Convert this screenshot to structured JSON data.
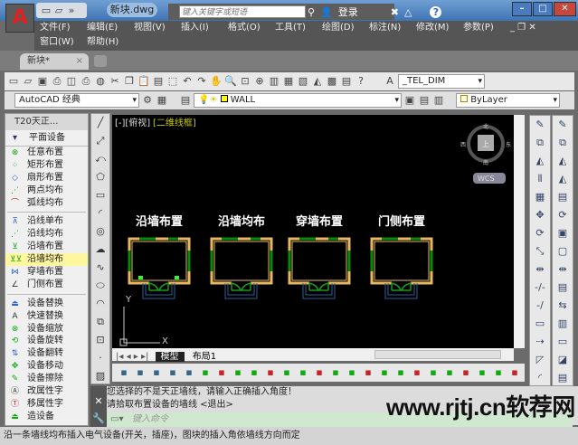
{
  "title": {
    "document": "新块.dwg",
    "search_placeholder": "键入关键字或短语",
    "login": "登录",
    "help": "?"
  },
  "menu": {
    "row1": [
      "文件(F)",
      "编辑(E)",
      "视图(V)",
      "插入(I)",
      "格式(O)",
      "工具(T)",
      "绘图(D)",
      "标注(N)",
      "修改(M)",
      "参数(P)"
    ],
    "row2": [
      "窗口(W)",
      "帮助(H)"
    ]
  },
  "doc_tab": {
    "label": "新块*",
    "close": "×"
  },
  "toolbar": {
    "textstyle": "_TEL_DIM",
    "workspace": "AutoCAD 经典",
    "layer": "WALL",
    "color": "ByLayer"
  },
  "panel": {
    "title": "T20天正...",
    "header": "平面设备",
    "groups": [
      [
        {
          "label": "任意布置",
          "icon": "⊗",
          "color": "#1a1"
        },
        {
          "label": "矩形布置",
          "icon": "⁘",
          "color": "#1a1"
        },
        {
          "label": "扇形布置",
          "icon": "◇",
          "color": "#36c"
        },
        {
          "label": "两点均布",
          "icon": "⋰",
          "color": "#1a1"
        },
        {
          "label": "弧线均布",
          "icon": "⌒",
          "color": "#c22"
        }
      ],
      [
        {
          "label": "沿线单布",
          "icon": "⊼",
          "color": "#36c"
        },
        {
          "label": "沿线均布",
          "icon": "⋰",
          "color": "#1a1"
        },
        {
          "label": "沿墙布置",
          "icon": "⊻",
          "color": "#1a1"
        },
        {
          "label": "沿墙均布",
          "icon": "⊻⊻",
          "color": "#1a1",
          "selected": true
        },
        {
          "label": "穿墙布置",
          "icon": "⋈",
          "color": "#36c"
        },
        {
          "label": "门侧布置",
          "icon": "∠",
          "color": "#333"
        }
      ],
      [
        {
          "label": "设备替换",
          "icon": "⏏",
          "color": "#36c"
        },
        {
          "label": "快速替换",
          "icon": "A",
          "color": "#333"
        },
        {
          "label": "设备缩放",
          "icon": "⊗",
          "color": "#1a1"
        },
        {
          "label": "设备旋转",
          "icon": "⟲",
          "color": "#1a1"
        },
        {
          "label": "设备翻转",
          "icon": "⇅",
          "color": "#36c"
        },
        {
          "label": "设备移动",
          "icon": "✥",
          "color": "#1a1"
        },
        {
          "label": "设备擦除",
          "icon": "✎",
          "color": "#1a1"
        },
        {
          "label": "改属性字",
          "icon": "Ⓐ",
          "color": "#333"
        },
        {
          "label": "移属性字",
          "icon": "Ⓣ",
          "color": "#c22"
        },
        {
          "label": "造设备",
          "icon": "⏏",
          "color": "#1a1"
        }
      ]
    ]
  },
  "viewport": {
    "label_prefix": "[-][俯视]",
    "label_style": "[二维线框]",
    "compass": {
      "north": "北",
      "south": "南",
      "east": "东",
      "west": "西",
      "center": "上"
    },
    "wcs": "WCS",
    "axis_x": "X",
    "axis_y": "Y"
  },
  "drawing": {
    "rooms": [
      "沿墙布置",
      "沿墙均布",
      "穿墙布置",
      "门侧布置"
    ]
  },
  "layout_tabs": {
    "model": "模型",
    "layout1": "布局1"
  },
  "command": {
    "history": [
      "您选择的不是天正墙线，请输入正确插入角度！",
      "请拾取布置设备的墙线 <退出>"
    ],
    "placeholder": "键入命令"
  },
  "status": "沿一条墙线均布插入电气设备(开关，插座)，图块的插入角依墙线方向而定",
  "watermark": "www.rjtj.cn软荐网",
  "colors": {
    "wall": "#e8b860",
    "window": "#0a8a0a",
    "door": "#1a9a1a",
    "canvas": "#000000"
  }
}
